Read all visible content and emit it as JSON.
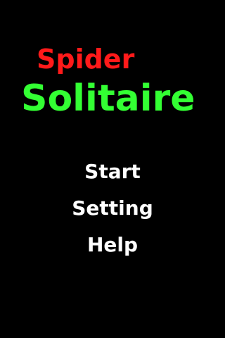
{
  "title": {
    "line1": "Spider",
    "line2": "Solitaire"
  },
  "menu": {
    "items": [
      {
        "label": "Start"
      },
      {
        "label": "Setting"
      },
      {
        "label": "Help"
      }
    ]
  },
  "colors": {
    "background": "#000000",
    "title_line1": "#ff1a1a",
    "title_line2": "#33ff33",
    "menu_text": "#ffffff"
  }
}
